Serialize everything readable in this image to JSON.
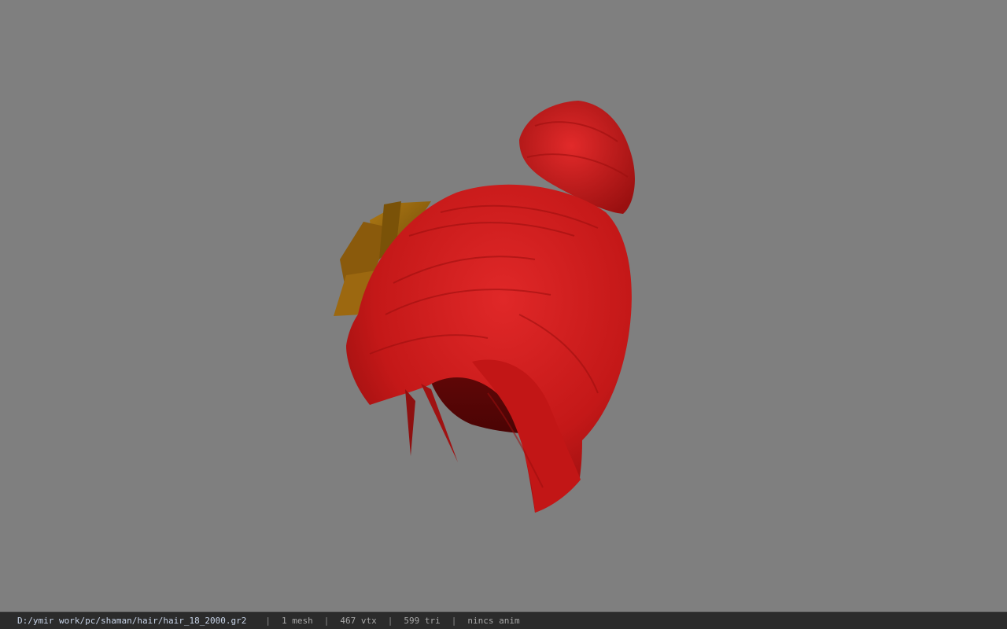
{
  "viewer": {
    "background_color": "#7f7f7f",
    "model": {
      "description_icon": "hair-mesh-render",
      "hair_color": "#d01c1c",
      "accessory_color": "#a56b10"
    }
  },
  "status_bar": {
    "file_path": "D:/ymir work/pc/shaman/hair/hair_18_2000.gr2",
    "separator": "|",
    "mesh_count": "1 mesh",
    "vertex_count": "467 vtx",
    "triangle_count": "599 tri",
    "animation_status": "nincs anim"
  }
}
